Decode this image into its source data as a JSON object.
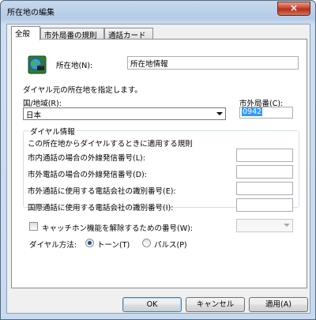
{
  "window": {
    "title": "所在地の編集",
    "close_glyph": "×"
  },
  "tabs": [
    {
      "label": "全般"
    },
    {
      "label": "市外局番の規則"
    },
    {
      "label": "通話カード"
    }
  ],
  "general": {
    "location_label": "所在地(N):",
    "location_value": "所在地情報",
    "specify_text": "ダイヤル元の所在地を指定します。",
    "country_label": "国/地域(R):",
    "country_value": "日本",
    "area_code_label": "市外局番(C):",
    "area_code_value": "0942",
    "group_title": "ダイヤル情報",
    "rules_text": "この所在地からダイヤルするときに適用する規則",
    "rows": [
      {
        "label": "市内通話の場合の外線発信番号(L):",
        "value": ""
      },
      {
        "label": "市外電話の場合の外線発信番号(D):",
        "value": ""
      },
      {
        "label": "市外通話に使用する電話会社の識別番号(E):",
        "value": ""
      },
      {
        "label": "国際通話に使用する電話会社の識別番号(I):",
        "value": ""
      }
    ],
    "call_waiting_label": "キャッチホン機能を解除するための番号(W):",
    "call_waiting_checked": false,
    "call_waiting_value": "",
    "dial_method_label": "ダイヤル方法:",
    "tone_label": "トーン(T)",
    "pulse_label": "パルス(P)",
    "dial_method_selected": "tone"
  },
  "buttons": {
    "ok": "OK",
    "cancel": "キャンセル",
    "apply": "適用(A)"
  },
  "icons": {
    "location": "phone-globe-icon"
  }
}
